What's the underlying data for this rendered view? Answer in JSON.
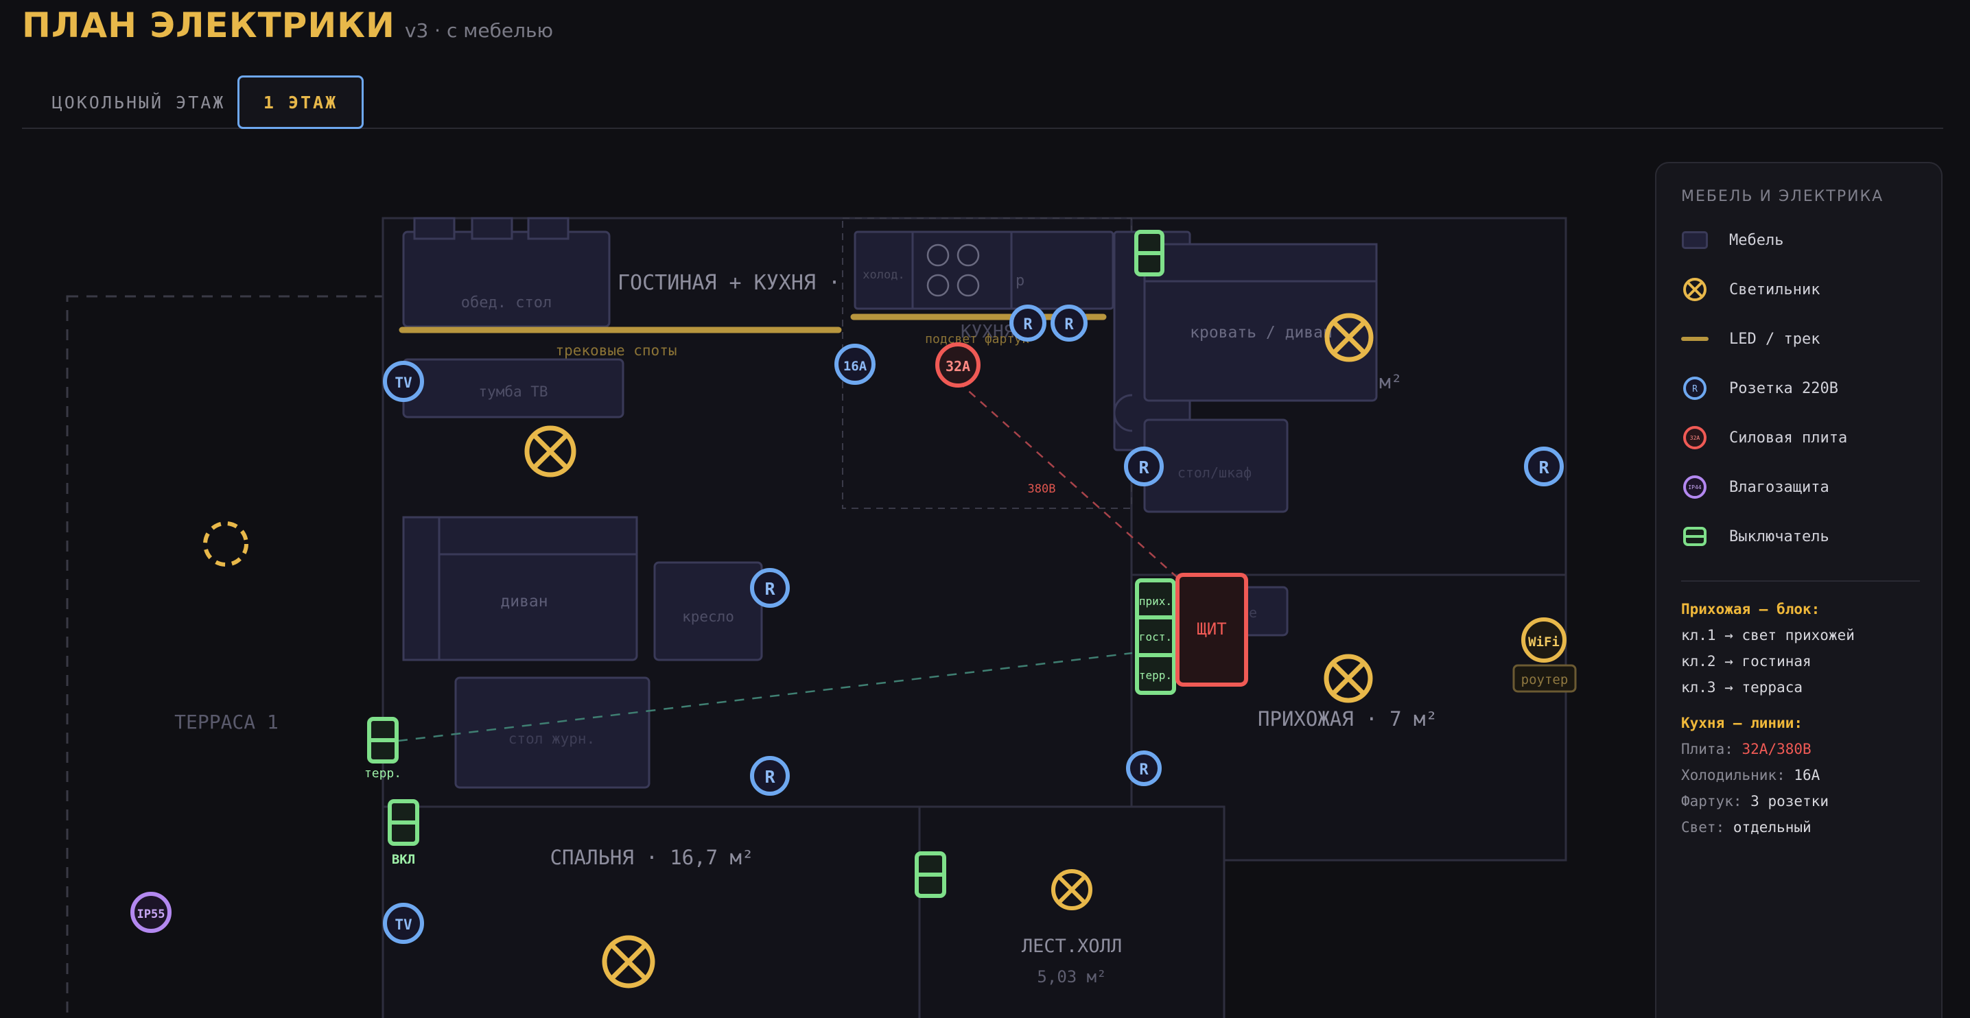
{
  "header": {
    "title": "ПЛАН ЭЛЕКТРИКИ",
    "subtitle": "v3 · с мебелью"
  },
  "tabs": [
    {
      "label": "ЦОКОЛЬНЫЙ ЭТАЖ",
      "active": false
    },
    {
      "label": "1 ЭТАЖ",
      "active": true
    }
  ],
  "rooms": {
    "living": "ГОСТИНАЯ + КУХНЯ · ",
    "kitchen": "КУХНЯ",
    "hall": "ПРИХОЖАЯ · 7 м²",
    "bedroom": "СПАЛЬНЯ · 16,7 м²",
    "stairs": "ЛЕСТ.ХОЛЛ",
    "stairs_area": "5,03 м²",
    "terrace": "ТЕРРАСА 1",
    "room_right_area": "м²"
  },
  "furniture": {
    "dining_table": "обед. стол",
    "tv_stand": "тумба ТВ",
    "sofa": "диван",
    "armchair": "кресло",
    "coffee_table": "стол журн.",
    "fridge": "холод.",
    "kitchen_cabinet": "р",
    "bed": "кровать / диван",
    "desk": "стол/шкаф",
    "hall_box": "е"
  },
  "labels": {
    "track_spots": "трековые споты",
    "apron_light": "подсвет фартук",
    "voltage_380": "380В",
    "panel": "ЩИТ",
    "panel_keys": [
      "прих.",
      "гост.",
      "терр."
    ],
    "terrace_switch": "терр.",
    "switch_on": "ВКЛ",
    "router": "роутер"
  },
  "markers": {
    "tv": "TV",
    "socket": "R",
    "fridge_socket": "16A",
    "stove": "32A",
    "wifi": "WiFi",
    "ip": "IP55"
  },
  "legend": {
    "title": "МЕБЕЛЬ И ЭЛЕКТРИКА",
    "items": [
      {
        "icon": "furniture-swatch",
        "label": "Мебель"
      },
      {
        "icon": "light-icon",
        "label": "Светильник"
      },
      {
        "icon": "led-track-line",
        "label": "LED / трек"
      },
      {
        "icon": "socket-icon",
        "label": "Розетка 220В",
        "glyph": "R"
      },
      {
        "icon": "stove-socket-icon",
        "label": "Силовая плита",
        "glyph": "32A"
      },
      {
        "icon": "moisture-icon",
        "label": "Влагозащита",
        "glyph": "IP44"
      },
      {
        "icon": "switch-icon",
        "label": "Выключатель"
      }
    ],
    "hall_block": {
      "title": "Прихожая — блок:",
      "lines": [
        "кл.1 → свет прихожей",
        "кл.2 → гостиная",
        "кл.3 → терраса"
      ]
    },
    "kitchen_lines": {
      "title": "Кухня — линии:",
      "rows": [
        {
          "key": "Плита:",
          "value": "32А/380В"
        },
        {
          "key": "Холодильник:",
          "value": "16А"
        },
        {
          "key": "Фартук:",
          "value": "3 розетки"
        },
        {
          "key": "Свет:",
          "value": "отдельный"
        }
      ]
    }
  },
  "colors": {
    "accent": "#e8b84a",
    "socket": "#6ea8f0",
    "stove": "#f05a55",
    "switch": "#7fe08a",
    "moisture": "#b388f0",
    "furniture": "#1e1e33"
  }
}
